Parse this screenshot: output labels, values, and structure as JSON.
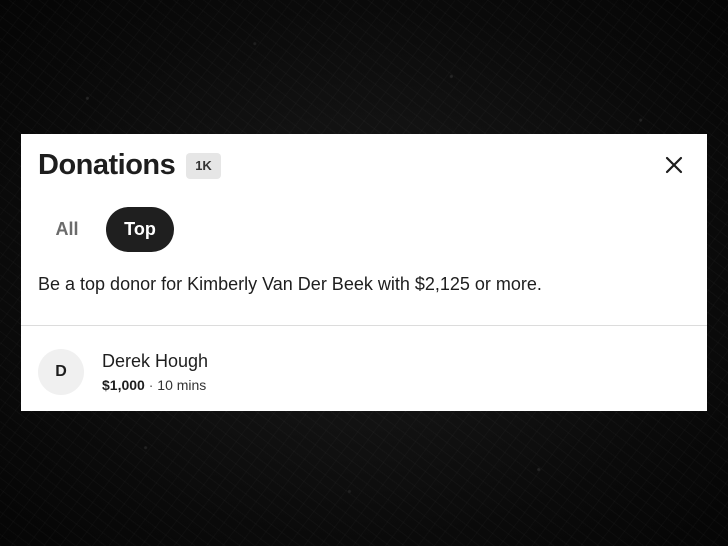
{
  "dialog": {
    "title": "Donations",
    "count_badge": "1K",
    "close_icon": "close-icon"
  },
  "tabs": [
    {
      "label": "All",
      "selected": false
    },
    {
      "label": "Top",
      "selected": true
    }
  ],
  "info_text": "Be a top donor for Kimberly Van Der Beek with $2,125 or more.",
  "donors": [
    {
      "initial": "D",
      "name": "Derek Hough",
      "amount": "$1,000",
      "separator": " · ",
      "time": "10 mins"
    }
  ],
  "colors": {
    "tab_selected_bg": "#1f1f1f",
    "tab_selected_text": "#ffffff",
    "tab_unselected_text": "#6b6b6b",
    "badge_bg": "#e6e6e6"
  }
}
